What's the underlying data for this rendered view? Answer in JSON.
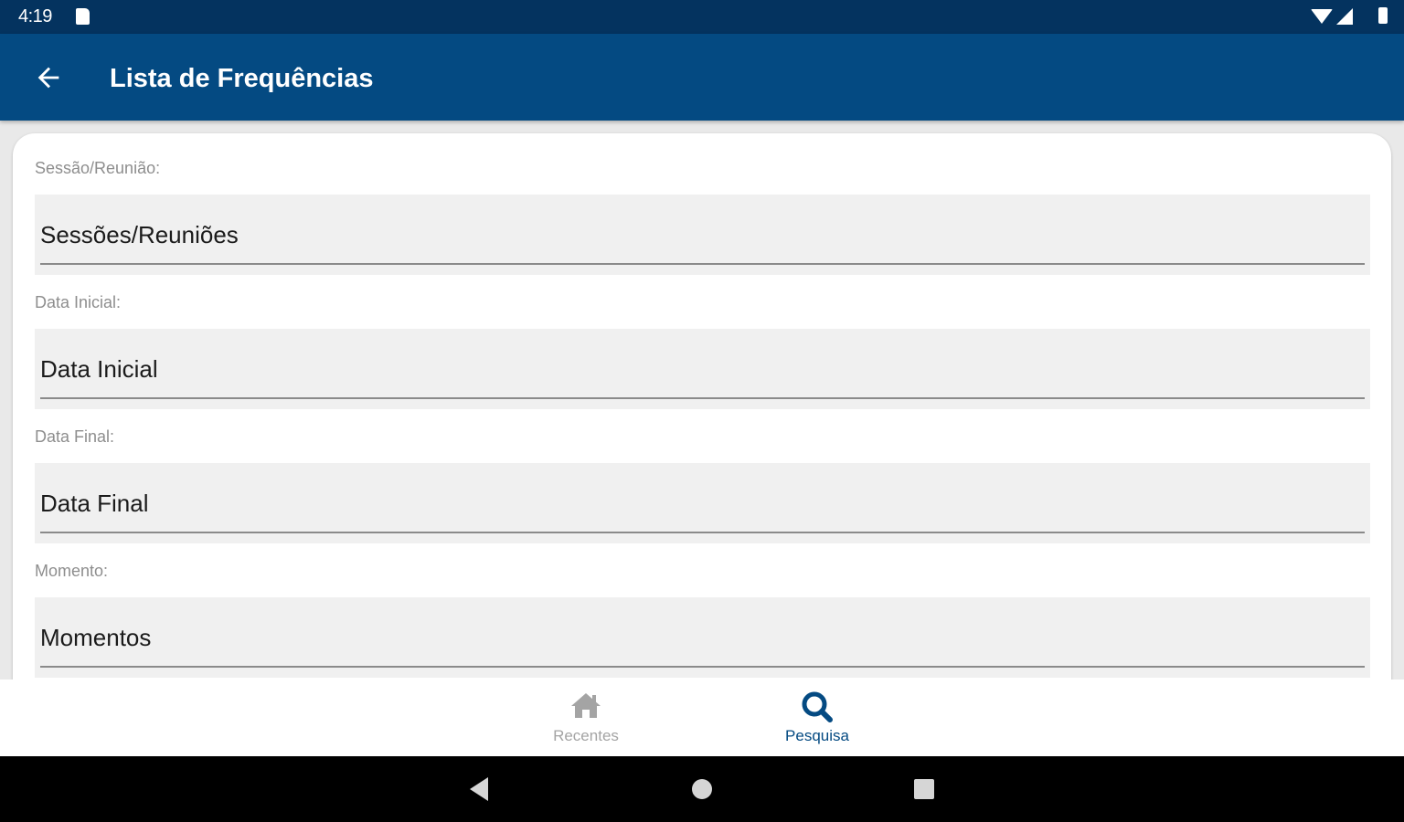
{
  "status_bar": {
    "time": "4:19",
    "icons": [
      "sd-card-icon",
      "wifi-icon",
      "signal-icon",
      "battery-icon"
    ]
  },
  "app_bar": {
    "title": "Lista de Frequências",
    "back_icon": "arrow-left-icon",
    "background": "#044a82"
  },
  "form": {
    "fields": [
      {
        "label": "Sessão/Reunião:",
        "value": "Sessões/Reuniões"
      },
      {
        "label": "Data Inicial:",
        "value": "Data Inicial"
      },
      {
        "label": "Data Final:",
        "value": "Data Final"
      },
      {
        "label": "Momento:",
        "value": "Momentos"
      }
    ]
  },
  "bottom_nav": {
    "items": [
      {
        "label": "Recentes",
        "icon": "home-icon",
        "active": false
      },
      {
        "label": "Pesquisa",
        "icon": "search-icon",
        "active": true
      }
    ],
    "active_color": "#044a82",
    "inactive_color": "#a4a4a4"
  },
  "system_nav": {
    "buttons": [
      "back-triangle-icon",
      "home-circle-icon",
      "recents-square-icon"
    ]
  }
}
